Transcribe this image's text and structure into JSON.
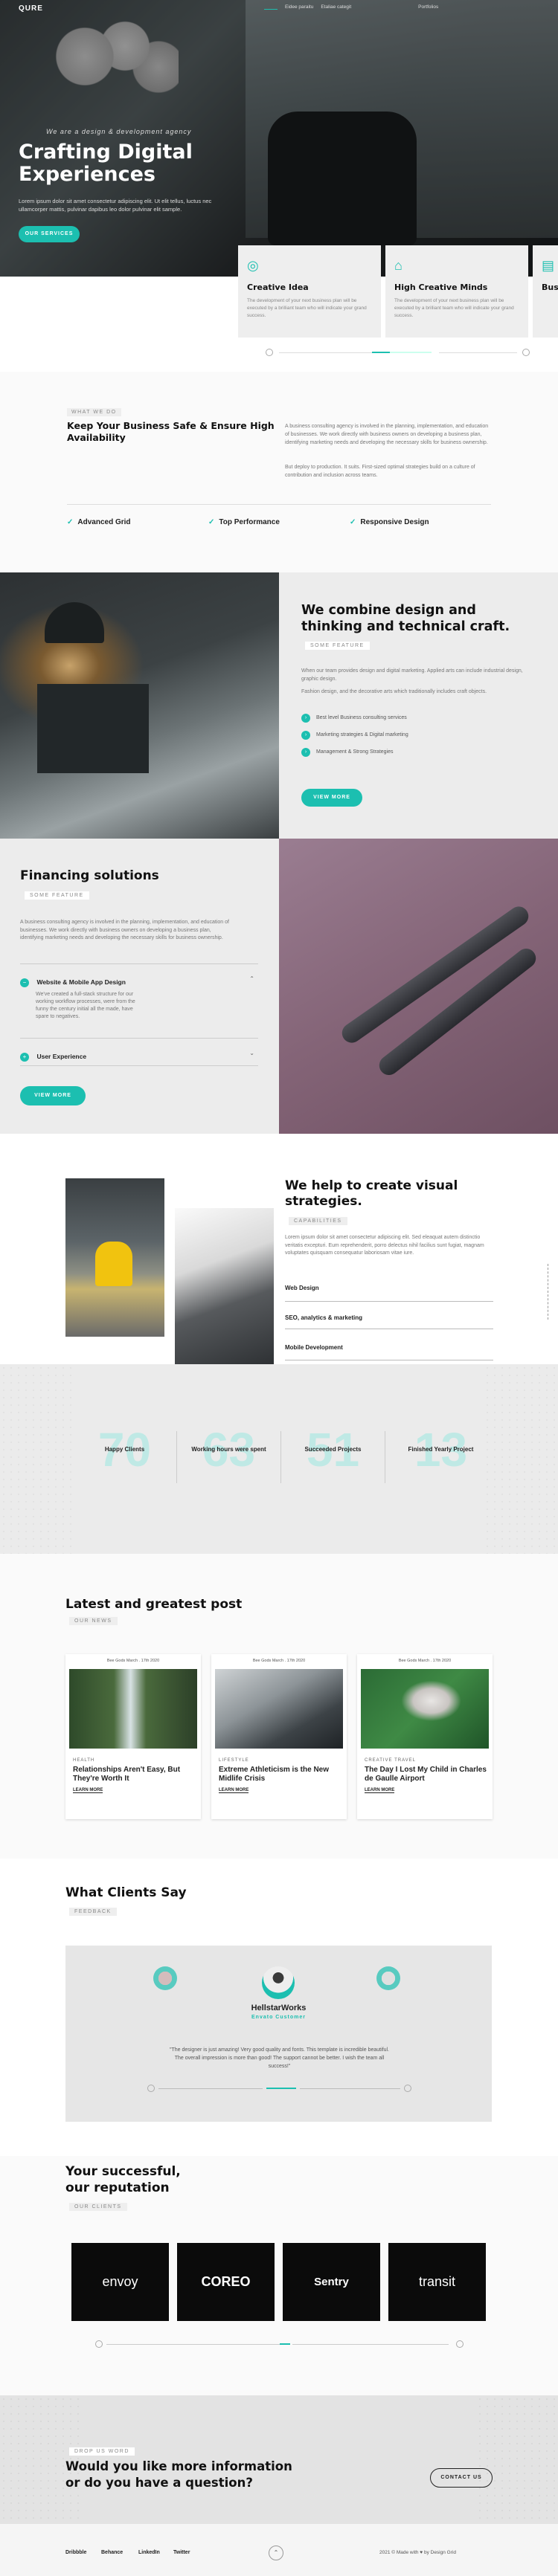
{
  "header": {
    "logo": "QURE",
    "nav": [
      "",
      "Eidee paraitu",
      "Etaliae categit",
      "",
      "",
      "Portfolios"
    ]
  },
  "hero": {
    "kicker": "We are a design & development agency",
    "title_line1": "Crafting Digital",
    "title_line2": "Experiences",
    "text": "Lorem ipsum dolor sit amet consectetur adipiscing elit. Ut elit tellus, luctus nec ullamcorper mattis, pulvinar dapibus leo dolor pulvinar elit sample.",
    "cta": "OUR SERVICES"
  },
  "feature_cards": [
    {
      "title": "Creative Idea",
      "text": "The development of your next business plan will be executed by a brilliant team who will indicate your grand success."
    },
    {
      "title": "High Creative Minds",
      "text": "The development of your next business plan will be executed by a brilliant team who will indicate your grand success."
    },
    {
      "title": "Busi",
      "text": "The de... be exe... your g..."
    }
  ],
  "safe": {
    "tag": "WHAT WE DO",
    "title": "Keep Your Business Safe & Ensure High Availability",
    "p1": "A business consulting agency is involved in the planning, implementation, and education of businesses. We work directly with business owners on developing a business plan, identifying marketing needs and developing the necessary skills for business ownership.",
    "p2": "But deploy to production. It suits. First-sized optimal strategies build on a culture of contribution and inclusion across teams.",
    "checks": [
      "Advanced Grid",
      "Top Performance",
      "Responsive Design"
    ]
  },
  "combine": {
    "title": "We combine design and thinking and technical craft.",
    "tag": "SOME FEATURE",
    "p1": "When our team provides design and digital marketing. Applied arts can include industrial design, graphic design.",
    "p2": "Fashion design, and the decorative arts which traditionally includes craft objects.",
    "items": [
      "Best level Business consulting services",
      "Marketing strategies & Digital marketing",
      "Management & Strong Strategies"
    ],
    "cta": "VIEW MORE"
  },
  "financing": {
    "title": "Financing solutions",
    "tag": "SOME FEATURE",
    "text": "A business consulting agency is involved in the planning, implementation, and education of businesses. We work directly with business owners on developing a business plan, identifying marketing needs and developing the necessary skills for business ownership.",
    "acc1_title": "Website & Mobile App Design",
    "acc1_text": "We've created a full-stack structure for our working workflow processes, were from the funny the century initial all the made, have spare to negatives.",
    "acc2_title": "User Experience",
    "cta": "VIEW MORE"
  },
  "strategies": {
    "title": "We help to create visual strategies.",
    "tag": "CAPABILITIES",
    "text": "Lorem ipsum dolor sit amet consectetur adipiscing elit. Sed eleaquat autem distinctio veritatis excepturi. Eum reprehenderit, porro delectus nihil facilius sunt fugiat, magnam voluptates quisquam consequatur laboriosam vitae iure.",
    "items": [
      "Web Design",
      "SEO, analytics & marketing",
      "Mobile Development"
    ]
  },
  "stats": [
    {
      "value": "70",
      "label": "Happy Clients"
    },
    {
      "value": "63",
      "label": "Working hours were spent"
    },
    {
      "value": "51",
      "label": "Succeeded Projects"
    },
    {
      "value": "13",
      "label": "Finished Yearly Project"
    }
  ],
  "posts": {
    "title": "Latest and greatest post",
    "tag": "OUR NEWS",
    "items": [
      {
        "meta": "Bee Gods  March . 17th 2020",
        "cat": "HEALTH",
        "title": "Relationships Aren't Easy, But They're Worth It",
        "more": "LEARN MORE"
      },
      {
        "meta": "Bee Gods  March . 17th 2020",
        "cat": "LIFESTYLE",
        "title": "Extreme Athleticism is the New Midlife Crisis",
        "more": "LEARN MORE"
      },
      {
        "meta": "Bee Gods  March . 17th 2020",
        "cat": "CREATIVE   TRAVEL",
        "title": "The Day I Lost My Child in Charles de Gaulle Airport",
        "more": "LEARN MORE"
      }
    ]
  },
  "clients_say": {
    "title": "What Clients Say",
    "tag": "FEEDBACK",
    "name": "HellstarWorks",
    "role": "Envato Customer",
    "quote": "\"The designer is just amazing! Very good quality and fonts. This template is incredible beautiful. The overall impression is more than good! The support cannot be better. I wish the team all success!\""
  },
  "reputation": {
    "title_line1": "Your successful,",
    "title_line2": "our reputation",
    "tag": "OUR CLIENTS",
    "logos": [
      "envoy",
      "COREO",
      "Sentry",
      "transit"
    ]
  },
  "contact": {
    "tag": "DROP US WORD",
    "title_line1": "Would you like more information",
    "title_line2": "or do you have a question?",
    "cta": "CONTACT US"
  },
  "footer": {
    "links": [
      "Dribbble",
      "Behance",
      "LinkedIn",
      "Twitter"
    ],
    "copyright": "2021 © Made with ♥ by Design Grid"
  },
  "colors": {
    "accent": "#1cbfb0",
    "dark": "#2b2b2b",
    "mauve": "#8a6a80"
  }
}
